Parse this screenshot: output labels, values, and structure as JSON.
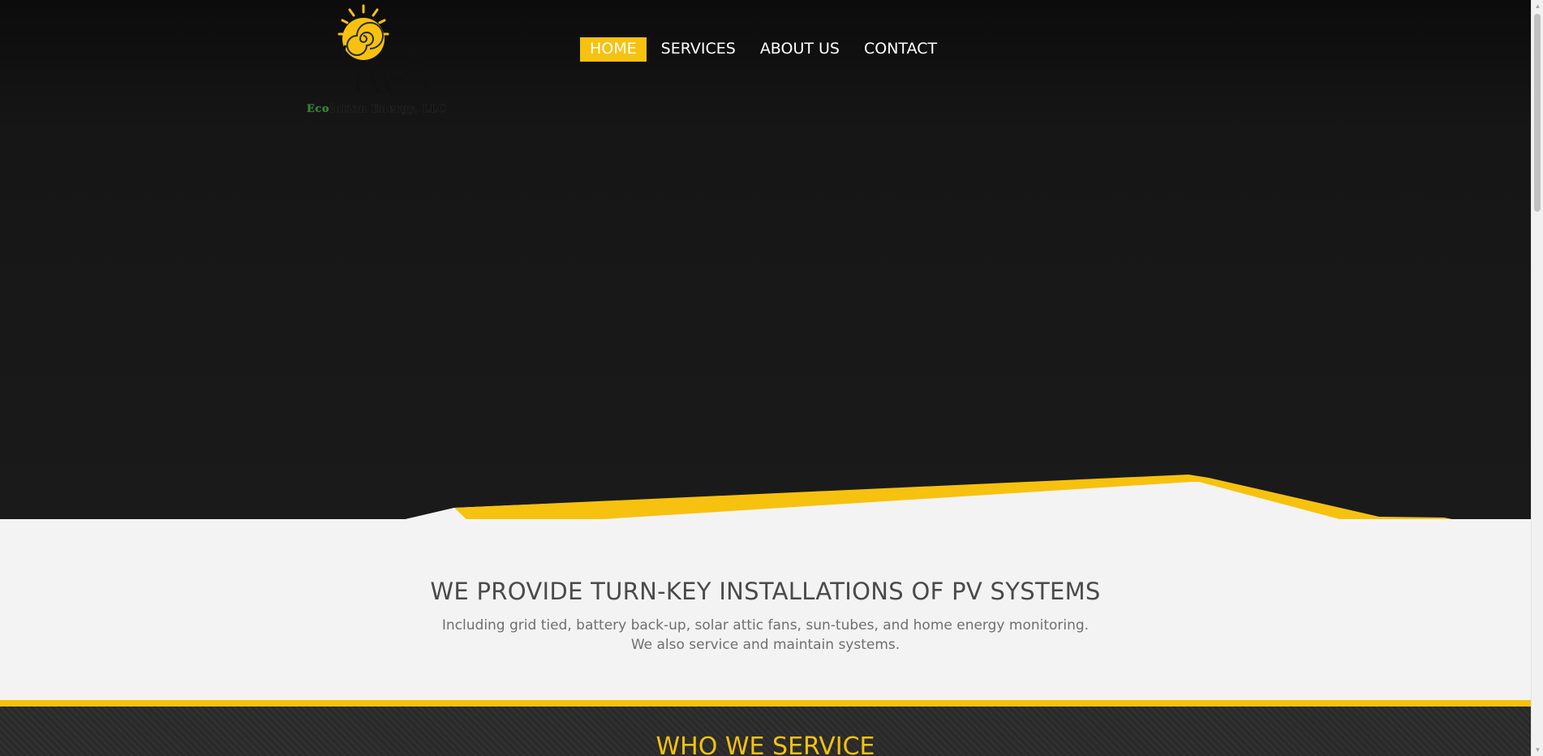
{
  "logo": {
    "prefix": "Eco",
    "text": "lution Energy, LLC"
  },
  "nav": {
    "items": [
      {
        "label": "HOME",
        "active": true
      },
      {
        "label": "SERVICES",
        "active": false
      },
      {
        "label": "ABOUT US",
        "active": false
      },
      {
        "label": "CONTACT",
        "active": false
      }
    ]
  },
  "intro": {
    "title": "WE PROVIDE TURN-KEY INSTALLATIONS OF PV SYSTEMS",
    "line1": "Including grid tied, battery back-up, solar attic fans, sun-tubes, and home energy monitoring.",
    "line2": "We also service and maintain systems."
  },
  "who": {
    "title": "WHO WE SERVICE"
  },
  "colors": {
    "accent": "#f6c20f",
    "dark": "#1a1a1a",
    "light": "#f3f3f3",
    "logo_green": "#2f8a2f"
  },
  "icons": {
    "scroll_up": "triangle-up",
    "scroll_down": "triangle-down"
  }
}
